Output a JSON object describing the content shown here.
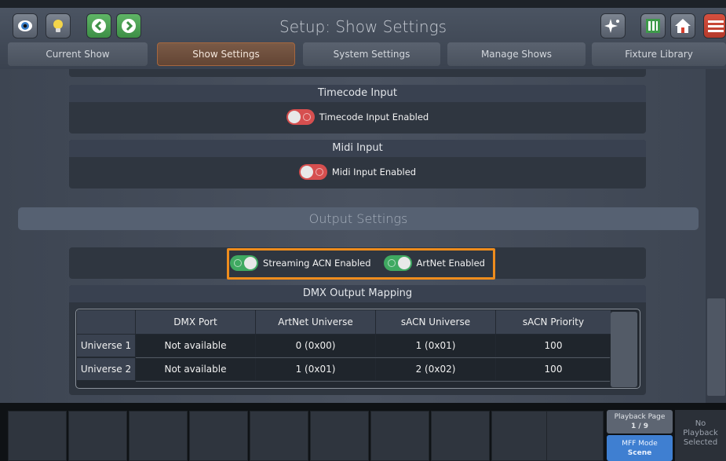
{
  "header": {
    "title": "Setup: Show Settings",
    "left_icons": [
      "eye-icon",
      "lightbulb-icon",
      "chevron-left-icon",
      "chevron-right-icon"
    ],
    "right_icons": [
      "sparkle-icon",
      "fader-icon",
      "home-icon",
      "menu-icon"
    ],
    "tabs": [
      {
        "label": "Current Show",
        "active": false
      },
      {
        "label": "Show Settings",
        "active": true
      },
      {
        "label": "System Settings",
        "active": false
      },
      {
        "label": "Manage Shows",
        "active": false
      },
      {
        "label": "Fixture Library",
        "active": false
      }
    ]
  },
  "timecode": {
    "title": "Timecode Input",
    "toggle_label": "Timecode Input Enabled",
    "enabled": false
  },
  "midi": {
    "title": "Midi Input",
    "toggle_label": "Midi Input Enabled",
    "enabled": false
  },
  "output": {
    "section_title": "Output Settings",
    "sacn_label": "Streaming ACN Enabled",
    "sacn_enabled": true,
    "artnet_label": "ArtNet Enabled",
    "artnet_enabled": true
  },
  "dmx": {
    "title": "DMX Output Mapping",
    "columns": [
      "DMX Port",
      "ArtNet Universe",
      "sACN Universe",
      "sACN Priority"
    ],
    "rows": [
      {
        "name": "Universe 1",
        "cells": [
          "Not available",
          "0 (0x00)",
          "1 (0x01)",
          "100"
        ]
      },
      {
        "name": "Universe 2",
        "cells": [
          "Not available",
          "1 (0x01)",
          "2 (0x02)",
          "100"
        ]
      }
    ]
  },
  "footer": {
    "playback_page_label": "Playback Page",
    "playback_page_value": "1 / 9",
    "mff_label": "MFF Mode",
    "mff_value": "Scene",
    "no_playback_line1": "No",
    "no_playback_line2": "Playback",
    "no_playback_line3": "Selected"
  },
  "colors": {
    "accent_orange": "#ee8c1d",
    "toggle_on": "#3fa961",
    "toggle_off": "#d64f4f",
    "active_tab": "#7a5a47",
    "mff_blue": "#3f7fd1"
  }
}
